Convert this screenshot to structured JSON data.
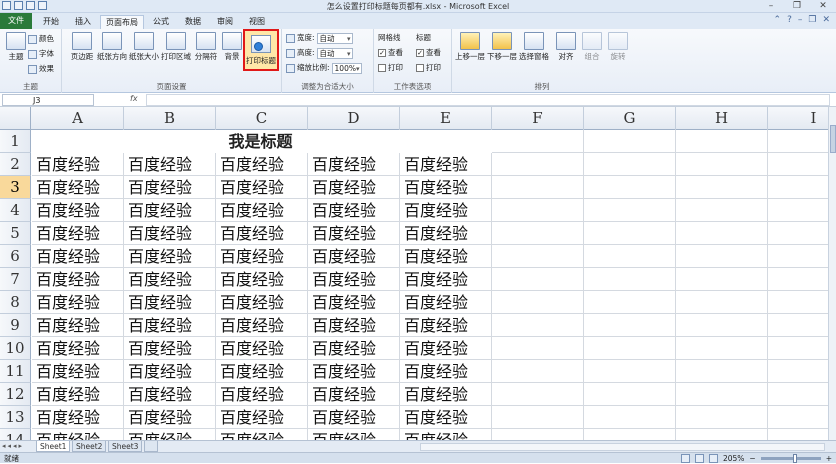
{
  "window": {
    "title": "怎么设置打印标题每页都有.xlsx - Microsoft Excel",
    "min": "–",
    "restore": "❐",
    "close": "✕"
  },
  "tabs": [
    "文件",
    "开始",
    "插入",
    "页面布局",
    "公式",
    "数据",
    "审阅",
    "视图"
  ],
  "active_tab": "页面布局",
  "help_icons": [
    "⌃",
    "?",
    "–",
    "❐",
    "✕"
  ],
  "ribbon": {
    "theme_group": {
      "label": "主题",
      "big": "主题",
      "colors": "颜色",
      "fonts": "字体",
      "effects": "效果"
    },
    "page_setup_group": {
      "label": "页面设置",
      "buttons": [
        "页边距",
        "纸张方向",
        "纸张大小",
        "打印区域",
        "分隔符",
        "背景",
        "打印标题"
      ]
    },
    "scale_group": {
      "label": "调整为合适大小",
      "width_label": "宽度:",
      "width_val": "自动",
      "height_label": "高度:",
      "height_val": "自动",
      "scale_label": "缩放比例:",
      "scale_val": "100%"
    },
    "sheet_options_group": {
      "label": "工作表选项",
      "gridlines": "网格线",
      "headings": "标题",
      "view": "查看",
      "print": "打印"
    },
    "arrange_group": {
      "label": "排列",
      "buttons": [
        "上移一层",
        "下移一层",
        "选择窗格",
        "对齐",
        "组合",
        "旋转"
      ]
    }
  },
  "formula_bar": {
    "name_box": "J3",
    "fx": "fx",
    "content": ""
  },
  "columns": [
    "A",
    "B",
    "C",
    "D",
    "E",
    "F",
    "G",
    "H",
    "I"
  ],
  "rows": [
    "1",
    "2",
    "3",
    "4",
    "5",
    "6",
    "7",
    "8",
    "9",
    "10",
    "11",
    "12",
    "13",
    "14"
  ],
  "selected_row": "3",
  "title_text": "我是标题",
  "cell_text": "百度经验",
  "sheet_tabs": [
    "Sheet1",
    "Sheet2",
    "Sheet3"
  ],
  "status": {
    "ready": "就绪",
    "zoom": "205%",
    "zoom_minus": "−",
    "zoom_plus": "+"
  }
}
